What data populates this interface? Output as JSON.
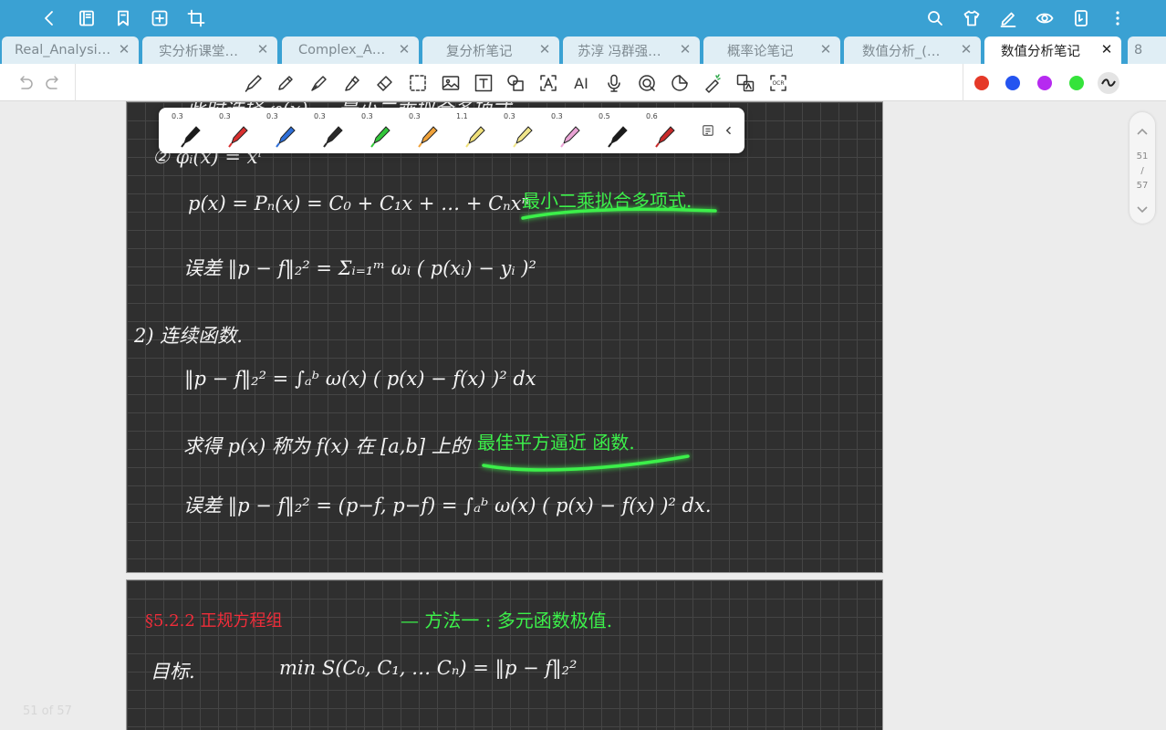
{
  "toolbar": {
    "left_icons": [
      "back-icon",
      "notebook-icon",
      "bookmark-icon",
      "add-page-icon",
      "crop-icon"
    ],
    "right_icons": [
      "search-icon",
      "shirt-icon",
      "pen-edit-icon",
      "eye-icon",
      "phone-tablet-icon",
      "more-icon"
    ]
  },
  "tabs": [
    {
      "label": "Real_Analysi…",
      "active": false
    },
    {
      "label": "实分析课堂…",
      "active": false
    },
    {
      "label": "Complex_A…",
      "active": false
    },
    {
      "label": "复分析笔记",
      "active": false
    },
    {
      "label": "苏淳 冯群强…",
      "active": false
    },
    {
      "label": "概率论笔记",
      "active": false
    },
    {
      "label": "数值分析_(…",
      "active": false
    },
    {
      "label": "数值分析笔记",
      "active": true
    }
  ],
  "tab_close": "✕",
  "tab_count": "8",
  "tools": [
    "undo-icon",
    "redo-icon",
    "pen-icon",
    "pencil-icon",
    "fountain-pen-icon",
    "highlighter-icon",
    "eraser-icon",
    "lasso-select-icon",
    "image-icon",
    "text-box-icon",
    "shape-icon",
    "text-recognize-icon",
    "ai-icon",
    "microphone-icon",
    "audio-icon",
    "sticker-icon",
    "laser-pointer-icon",
    "translate-icon",
    "ocr-icon"
  ],
  "tool_labels": {
    "text": "T",
    "ai": "AI",
    "ocr": "OCR"
  },
  "colors": [
    "#e53928",
    "#2454f0",
    "#b62af0",
    "#35e33b"
  ],
  "pens": [
    {
      "size": "0.3",
      "color": "#1b1b1b"
    },
    {
      "size": "0.3",
      "color": "#d93030"
    },
    {
      "size": "0.3",
      "color": "#2e6fd8"
    },
    {
      "size": "0.3",
      "color": "#2a2a2a"
    },
    {
      "size": "0.3",
      "color": "#32c63a"
    },
    {
      "size": "0.3",
      "color": "#f0a23a"
    },
    {
      "size": "1.1",
      "color": "#f0e07a"
    },
    {
      "size": "0.3",
      "color": "#f0e58a"
    },
    {
      "size": "0.3",
      "color": "#e9a3d4"
    },
    {
      "size": "0.5",
      "color": "#1b1b1b"
    },
    {
      "size": "0.6",
      "color": "#c82a2a"
    }
  ],
  "scroll": {
    "current": "51",
    "sep": "/",
    "total": "57"
  },
  "page_info": "51 of 57",
  "notes": {
    "line_top": "此时选择 φ(x) ... 最小二乘拟合多项式",
    "item2": "② φᵢ(x) = xⁱ",
    "poly": "p(x) = Pₙ(x) = C₀ + C₁x + … + Cₙxⁿ",
    "poly_label": "最小二乘拟合多项式.",
    "err_discrete": "误差 ‖p − f‖₂² = Σᵢ₌₁ᵐ ωᵢ ( p(xᵢ) − yᵢ )²",
    "cont_head": "2) 连续函数.",
    "cont_norm": "‖p − f‖₂² = ∫ₐᵇ ω(x) ( p(x) − f(x) )² dx",
    "best_text": "求得 p(x) 称为 f(x) 在 [a,b] 上的",
    "best_label": "最佳平方逼近 函数.",
    "err_cont": "误差 ‖p − f‖₂² = (p−f, p−f) = ∫ₐᵇ ω(x) ( p(x) − f(x) )² dx.",
    "sec_head": "§5.2.2  正规方程组",
    "sec_method": "—  方法一 : 多元函数极值.",
    "goal_label": "目标.",
    "goal_formula": "min S(C₀, C₁, … Cₙ) = ‖p − f‖₂²"
  }
}
